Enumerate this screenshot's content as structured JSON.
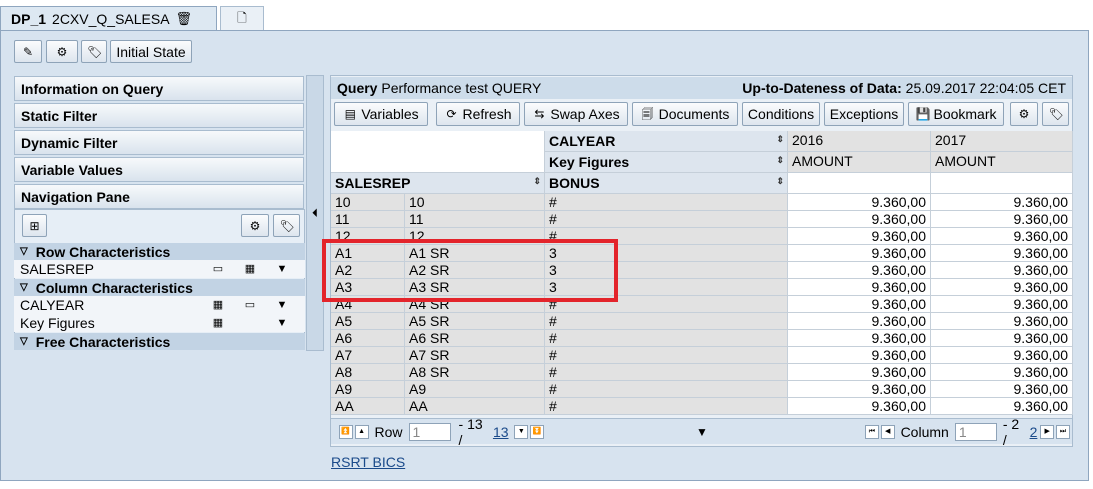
{
  "tabs": {
    "tab1_bold": "DP_1",
    "tab1_rest": "2CXV_Q_SALESA",
    "tab1_delete_icon": "trash-icon",
    "tab2_icon": "new-page-icon"
  },
  "top_toolbar": {
    "initial_state_label": "Initial State",
    "icons": [
      "edit-icon",
      "settings-icon",
      "tag-icon"
    ]
  },
  "left_panel": {
    "headers": [
      "Information on Query",
      "Static Filter",
      "Dynamic Filter",
      "Variable Values",
      "Navigation Pane"
    ],
    "row_characteristics_title": "Row Characteristics",
    "row_characteristics": [
      "SALESREP"
    ],
    "column_characteristics_title": "Column Characteristics",
    "column_characteristics": [
      "CALYEAR",
      "Key Figures"
    ],
    "free_characteristics_title": "Free Characteristics"
  },
  "query_header": {
    "label": "Query",
    "name": "Performance test QUERY",
    "uptodate_label": "Up-to-Dateness of Data:",
    "uptodate_value": "25.09.2017 22:04:05 CET"
  },
  "query_toolbar": {
    "variables": "Variables",
    "refresh": "Refresh",
    "swap_axes": "Swap Axes",
    "documents": "Documents",
    "conditions": "Conditions",
    "exceptions": "Exceptions",
    "bookmark": "Bookmark"
  },
  "grid": {
    "calyear_label": "CALYEAR",
    "key_figures_label": "Key Figures",
    "salesrep_label": "SALESREP",
    "bonus_label": "BONUS",
    "years": [
      "2016",
      "2017"
    ],
    "amount_label": "AMOUNT",
    "rows": [
      {
        "key": "10",
        "text": "10",
        "bonus": "#",
        "v2016": "9.360,00",
        "v2017": "9.360,00"
      },
      {
        "key": "11",
        "text": "11",
        "bonus": "#",
        "v2016": "9.360,00",
        "v2017": "9.360,00"
      },
      {
        "key": "12",
        "text": "12",
        "bonus": "#",
        "v2016": "9.360,00",
        "v2017": "9.360,00"
      },
      {
        "key": "A1",
        "text": "A1 SR",
        "bonus": "3",
        "v2016": "9.360,00",
        "v2017": "9.360,00"
      },
      {
        "key": "A2",
        "text": "A2 SR",
        "bonus": "3",
        "v2016": "9.360,00",
        "v2017": "9.360,00"
      },
      {
        "key": "A3",
        "text": "A3 SR",
        "bonus": "3",
        "v2016": "9.360,00",
        "v2017": "9.360,00"
      },
      {
        "key": "A4",
        "text": "A4 SR",
        "bonus": "#",
        "v2016": "9.360,00",
        "v2017": "9.360,00"
      },
      {
        "key": "A5",
        "text": "A5 SR",
        "bonus": "#",
        "v2016": "9.360,00",
        "v2017": "9.360,00"
      },
      {
        "key": "A6",
        "text": "A6 SR",
        "bonus": "#",
        "v2016": "9.360,00",
        "v2017": "9.360,00"
      },
      {
        "key": "A7",
        "text": "A7 SR",
        "bonus": "#",
        "v2016": "9.360,00",
        "v2017": "9.360,00"
      },
      {
        "key": "A8",
        "text": "A8 SR",
        "bonus": "#",
        "v2016": "9.360,00",
        "v2017": "9.360,00"
      },
      {
        "key": "A9",
        "text": "A9",
        "bonus": "#",
        "v2016": "9.360,00",
        "v2017": "9.360,00"
      },
      {
        "key": "AA",
        "text": "AA",
        "bonus": "#",
        "v2016": "9.360,00",
        "v2017": "9.360,00"
      }
    ]
  },
  "pager": {
    "row_label": "Row",
    "row_input": "1",
    "row_range": "- 13 /",
    "row_total": "13",
    "column_label": "Column",
    "column_input": "1",
    "column_range": "- 2 /",
    "column_total": "2"
  },
  "footer_link": "RSRT BICS",
  "colors": {
    "highlight": "#e3242b",
    "frame_bg": "#d7e3ef"
  }
}
